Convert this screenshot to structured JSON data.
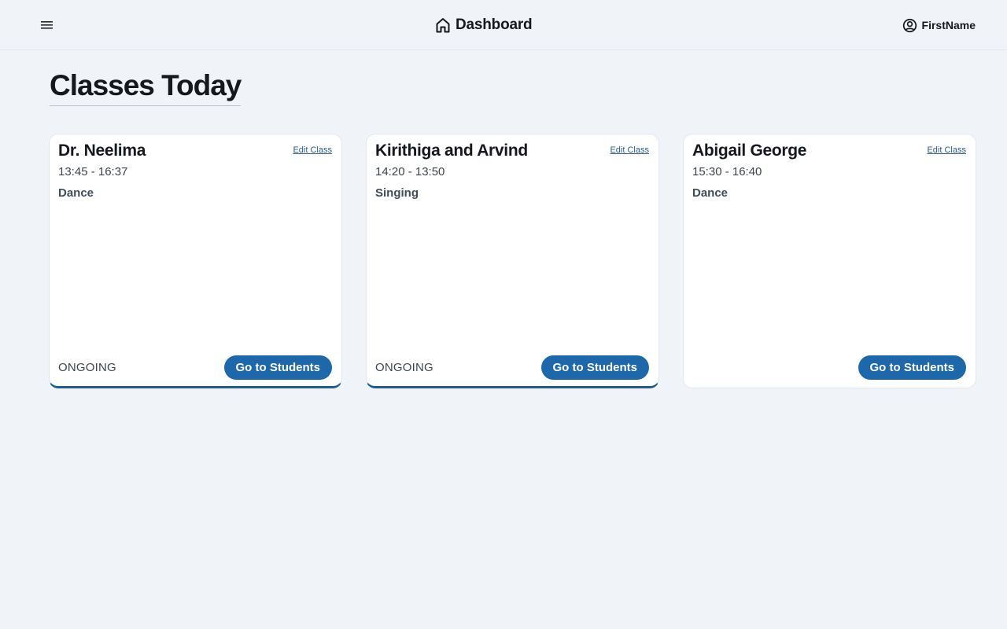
{
  "header": {
    "title": "Dashboard",
    "user_name": "FirstName"
  },
  "page": {
    "title": "Classes Today"
  },
  "cards": [
    {
      "name": "Dr. Neelima",
      "time": "13:45 - 16:37",
      "subject": "Dance",
      "status": "ONGOING",
      "edit_label": "Edit Class",
      "button_label": "Go to Students"
    },
    {
      "name": "Kirithiga and Arvind",
      "time": "14:20 - 13:50",
      "subject": "Singing",
      "status": "ONGOING",
      "edit_label": "Edit Class",
      "button_label": "Go to Students"
    },
    {
      "name": "Abigail George",
      "time": "15:30 - 16:40",
      "subject": "Dance",
      "status": "",
      "edit_label": "Edit Class",
      "button_label": "Go to Students"
    }
  ],
  "icons": {
    "menu": "menu-icon",
    "home": "home-icon",
    "user": "user-circle-icon"
  },
  "colors": {
    "background": "#f0f4f9",
    "primary_button": "#1d68ab",
    "ongoing_border": "#1f5c95",
    "link": "#2c5d8c"
  }
}
